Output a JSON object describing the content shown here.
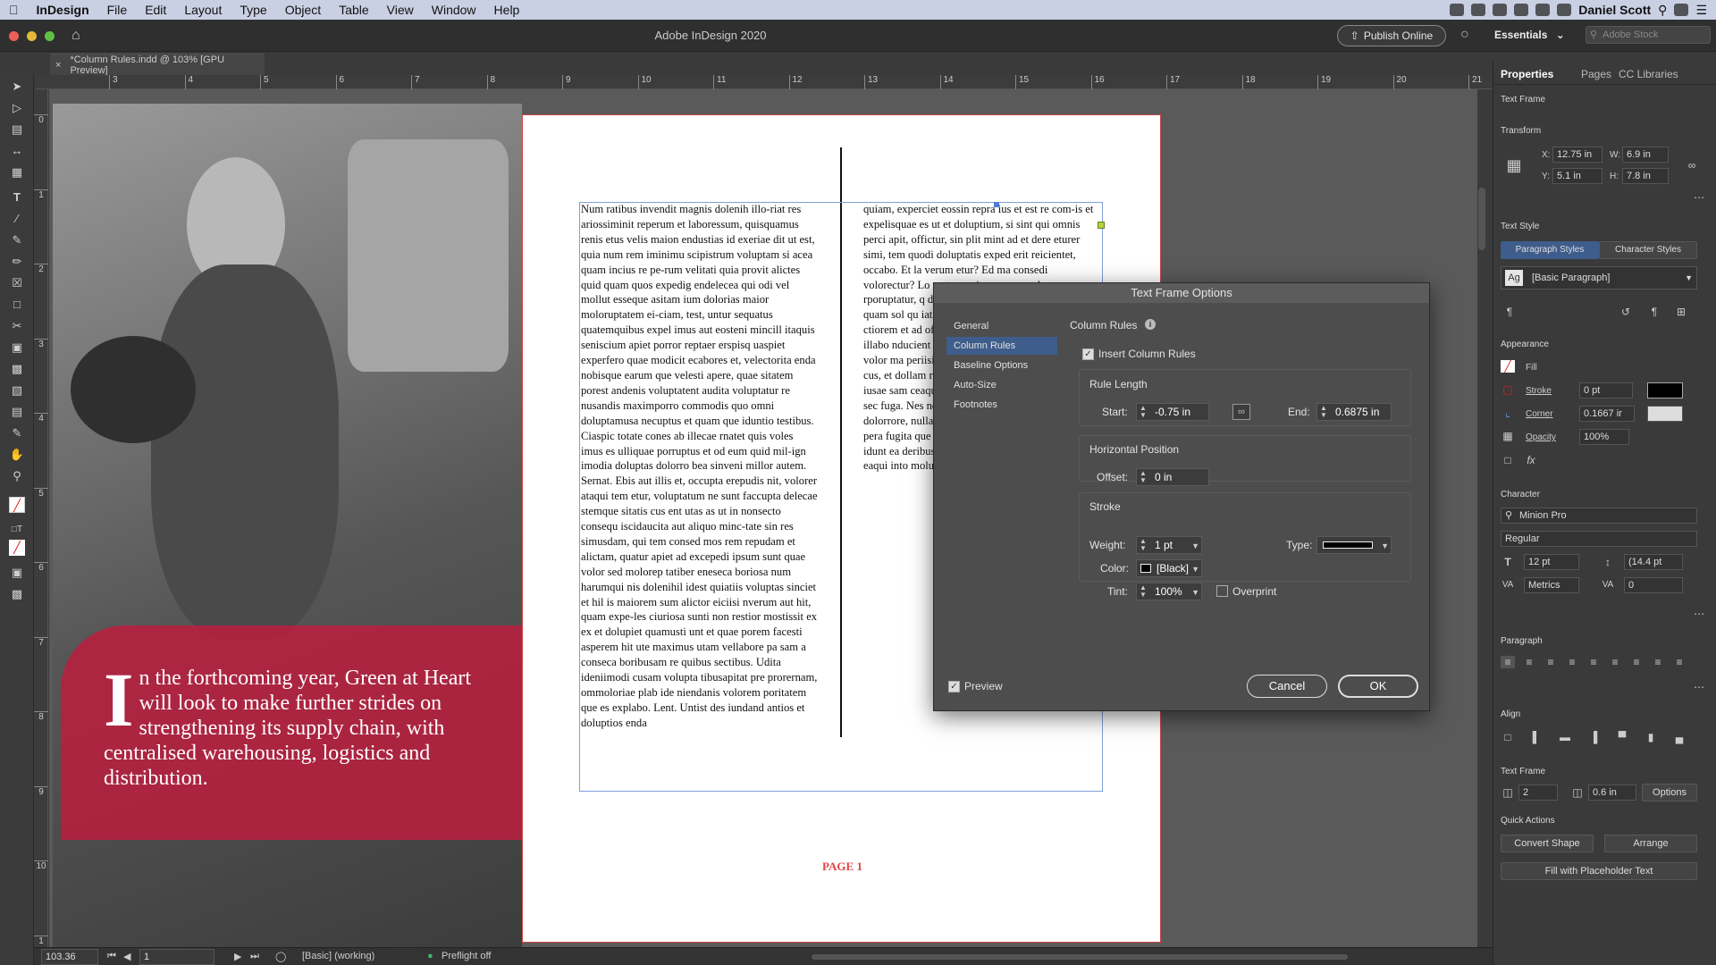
{
  "menubar": {
    "app_name": "InDesign",
    "items": [
      "File",
      "Edit",
      "Layout",
      "Type",
      "Object",
      "Table",
      "View",
      "Window",
      "Help"
    ],
    "user": "Daniel Scott"
  },
  "appbar": {
    "title": "Adobe InDesign 2020",
    "publish_label": "Publish Online",
    "workspace": "Essentials",
    "search_placeholder": "Adobe Stock"
  },
  "doc_tab": {
    "label": "*Column Rules.indd @ 103% [GPU Preview]"
  },
  "ruler": {
    "h_labels": [
      "3",
      "4",
      "5",
      "6",
      "7",
      "8",
      "9",
      "10",
      "11",
      "12",
      "13",
      "14",
      "15",
      "16",
      "17",
      "18",
      "19",
      "20",
      "21"
    ],
    "v_labels": [
      "0",
      "1",
      "2",
      "3",
      "4",
      "5",
      "6",
      "7",
      "8",
      "9",
      "10",
      "1"
    ]
  },
  "layout": {
    "pull_quote_cap": "I",
    "pull_quote": "n the forthcoming year, Green at Heart will look to make further strides on strengthening its supply chain, with centralised warehousing, logistics and distribution.",
    "column1": "Num ratibus invendit magnis dolenih illo-riat res ariossiminit reperum et laboressum, quisquamus renis etus velis maion endustias id exeriae dit ut est, quia num rem iminimu scipistrum voluptam si acea quam incius re pe-rum velitati quia provit alictes quid quam quos expedig endelecea qui odi vel mollut esseque asitam ium dolorias maior moloruptatem ei-ciam, test, untur sequatus quatemquibus expel imus aut eosteni mincill itaquis seniscium apiet porror reptaer erspisq uaspiet experfero quae modicit ecabores et, velectorita enda nobisque earum que velesti apere, quae sitatem porest andenis voluptatent audita voluptatur re nusandis maximporro commodis quo omni doluptamusa necuptus et quam que iduntio testibus. Ciaspic totate cones ab illecae rnatet quis voles imus es ulliquae porruptus et od eum quid mil-ign imodia doluptas dolorro bea sinveni millor autem. Sernat. Ebis aut illis et, occupta erepudis nit, volorer ataqui tem etur, voluptatum ne sunt faccupta delecae stemque sitatis cus ent utas as ut in nonsecto consequ iscidaucita aut aliquo minc-tate sin res simusdam, qui tem consed mos rem repudam et alictam, quatur apiet ad excepedi ipsum sunt quae volor sed molorep tatiber eneseca boriosa num harumqui nis dolenihil idest quiatiis voluptas sinciet et hil is maiorem sum alictor eiciisi nverum aut hit, quam expe-les ciuriosa sunti non restior mostissit ex ex et dolupiet quamusti unt et quae porem facesti asperem hit ute maximus utam vellabore pa sam a conseca boribusam re quibus sectibus. Udita ideniimodi cusam volupta tibusapitat pre prorernam, ommoloriae plab ide niendanis volorem poritatem que es explabo. Lent. Untist des iundand antios et doluptios enda",
    "column2": "quiam, experciet eossin repra ius et est re com-is et expelisquae es ut et doluptium, si sint qui omnis perci apit, offictur, sin plit mint ad et dere eturer simi, tem quodi doluptatis exped erit reicientet, occabo. Et la verum etur? Ed ma consedi volorectur? Lo metus antion expera volupta rporuptatur, q dolorero inver ciusci quidign sim quam sol qu iatiam qui Hictur adi dele eosant dolum ctiorem et ad officime sum doluptibusa se samenih illabo nducient acipsu dis sus si dolor asinus et volor ma periisiti to ulli quiducium luptatust incta cus, et dollam reptaquam, in Bis aut et fugi quid iusae sam ceaque. Nes ip Roviti aut mo et is doles sec fuga. Nes non des accuptatem harchilic totatios dolorrore, nullabore et quassum cum quam conecaer pera fugita que vent, nonse vollum dolumque vella idunt ea deribus cuptias es inus rae quo occum ad eaqui into moluptatur, secus maio volesciet,",
    "page_label": "PAGE 1"
  },
  "dialog": {
    "title": "Text Frame Options",
    "nav": [
      "General",
      "Column Rules",
      "Baseline Options",
      "Auto-Size",
      "Footnotes"
    ],
    "selected_nav": "Column Rules",
    "heading": "Column Rules",
    "insert_label": "Insert Column Rules",
    "insert_checked": true,
    "rule_length_label": "Rule Length",
    "start_label": "Start:",
    "start_value": "-0.75 in",
    "end_label": "End:",
    "end_value": "0.6875 in",
    "hpos_label": "Horizontal Position",
    "offset_label": "Offset:",
    "offset_value": "0 in",
    "stroke_label": "Stroke",
    "weight_label": "Weight:",
    "weight_value": "1 pt",
    "type_label": "Type:",
    "color_label": "Color:",
    "color_value": "[Black]",
    "tint_label": "Tint:",
    "tint_value": "100%",
    "overprint_label": "Overprint",
    "overprint_checked": false,
    "preview_label": "Preview",
    "preview_checked": true,
    "cancel_label": "Cancel",
    "ok_label": "OK"
  },
  "properties": {
    "tabs": [
      "Properties",
      "Pages",
      "CC Libraries"
    ],
    "object_type": "Text Frame",
    "transform_label": "Transform",
    "x_label": "X:",
    "x_value": "12.75 in",
    "y_label": "Y:",
    "y_value": "5.1 in",
    "w_label": "W:",
    "w_value": "6.9 in",
    "h_label": "H:",
    "h_value": "7.8 in",
    "text_style_label": "Text Style",
    "para_styles_tab": "Paragraph Styles",
    "char_styles_tab": "Character Styles",
    "style_value": "[Basic Paragraph]",
    "appearance_label": "Appearance",
    "fill_label": "Fill",
    "stroke_label": "Stroke",
    "stroke_value": "0 pt",
    "corner_label": "Corner",
    "corner_value": "0.1667 ir",
    "opacity_label": "Opacity",
    "opacity_value": "100%",
    "character_label": "Character",
    "font_value": "Minion Pro",
    "font_style_value": "Regular",
    "font_size_value": "12 pt",
    "leading_value": "(14.4 pt",
    "kerning_value": "Metrics",
    "tracking_value": "0",
    "paragraph_label": "Paragraph",
    "align_label": "Align",
    "text_frame_label": "Text Frame",
    "columns_value": "2",
    "gutter_value": "0.6 in",
    "options_label": "Options",
    "quick_actions_label": "Quick Actions",
    "convert_shape_label": "Convert Shape",
    "arrange_label": "Arrange",
    "fill_placeholder_label": "Fill with Placeholder Text"
  },
  "statusbar": {
    "zoom": "103.36",
    "page": "1",
    "style": "[Basic] (working)",
    "preflight": "Preflight off"
  },
  "colors": {
    "accent_red": "#c01c3e",
    "selection_blue": "#3e5d8c",
    "page_label_red": "#e04545"
  }
}
